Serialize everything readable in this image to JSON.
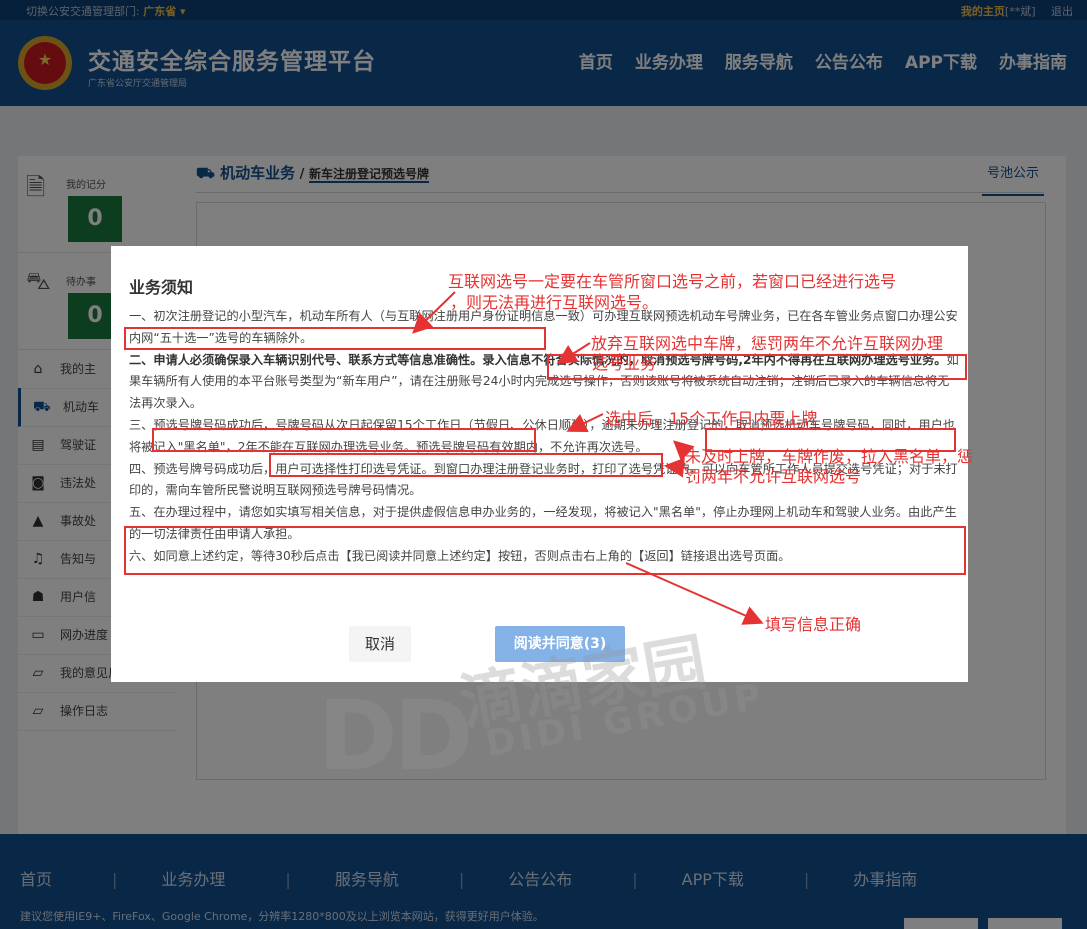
{
  "topbar": {
    "switch_label": "切换公安交通管理部门:",
    "province": "广东省 ▾",
    "my_home": "我的主页",
    "user": "[**斌]",
    "logout": "退出"
  },
  "header": {
    "title": "交通安全综合服务管理平台",
    "subtitle": "广东省公安厅交通管理局"
  },
  "nav": [
    "首页",
    "业务办理",
    "服务导航",
    "公告公布",
    "APP下载",
    "办事指南"
  ],
  "sidebar": {
    "my_points": {
      "label": "我的记分",
      "value": "0"
    },
    "pending": {
      "label": "待办事",
      "value": "0"
    },
    "items": [
      "我的主",
      "机动车",
      "驾驶证",
      "违法处",
      "事故处",
      "告知与",
      "用户信",
      "网办进度",
      "我的意见反馈",
      "操作日志"
    ]
  },
  "main": {
    "crumb_parent": "机动车业务",
    "crumb_sep": " / ",
    "crumb_current": "新车注册登记预选号牌",
    "pool_notice": "号池公示"
  },
  "modal": {
    "title": "业务须知",
    "p1": "一、初次注册登记的小型汽车，机动车所有人（与互联网注册用户身份证明信息一致）可办理互联网预选机动车号牌业务，已在各车管业务点窗口办理公安内网“五十选一”选号的车辆除外。",
    "p2_bold1": "二、申请人必须确保录入车辆识别代号、联系方式等信息准确性。录入信息不符合实际情况的，取消预选号牌号码,2年内不得再在互联网办理选号业务。",
    "p2_rest": "如果车辆所有人使用的本平台账号类型为“新车用户”，请在注册账号24小时内完成选号操作，否则该账号将被系统自动注销；注销后已录入的车辆信息将无法再次录入。",
    "p3": "三、预选号牌号码成功后，号牌号码从次日起保留15个工作日（节假日、公休日顺延），逾期未办理注册登记的，取消预选机动车号牌号码，同时，用户也将被记入\"黑名单\"，2年不能在互联网办理选号业务。预选号牌号码有效期内，不允许再次选号。",
    "p4": "四、预选号牌号码成功后，用户可选择性打印选号凭证。到窗口办理注册登记业务时，打印了选号凭证的，可以向车管所工作人员提交选号凭证；对于未打印的，需向车管所民警说明互联网预选号牌号码情况。",
    "p5": "五、在办理过程中，请您如实填写相关信息，对于提供虚假信息申办业务的，一经发现，将被记入\"黑名单\"，停止办理网上机动车和驾驶人业务。由此产生的一切法律责任由申请人承担。",
    "p6": "六、如同意上述约定，等待30秒后点击【我已阅读并同意上述约定】按钮，否则点击右上角的【返回】链接退出选号页面。",
    "cancel": "取消",
    "agree": "阅读并同意(3)"
  },
  "annotations": {
    "a1_line1": "互联网选号一定要在车管所窗口选号之前，若窗口已经进行选号",
    "a1_line2": "，则无法再进行互联网选号。",
    "a2_line1": "放弃互联网选中车牌，惩罚两年不允许互联网办理",
    "a2_line2": "选号业务",
    "a3": "选中后，15个工作日内要上牌",
    "a4_line1": "未及时上牌，车牌作废，拉入黑名单，惩",
    "a4_line2": "罚两年不允许互联网选号",
    "a5": "填写信息正确"
  },
  "watermark": {
    "brand": "DD",
    "cn": "滴滴家园",
    "en": "DIDI GROUP"
  },
  "footer": {
    "nav": [
      "首页",
      "业务办理",
      "服务导航",
      "公告公布",
      "APP下载",
      "办事指南"
    ],
    "tip": "建议您使用IE9+、FireFox、Google Chrome，分辨率1280*800及以上浏览本网站，获得更好用户体验。"
  }
}
